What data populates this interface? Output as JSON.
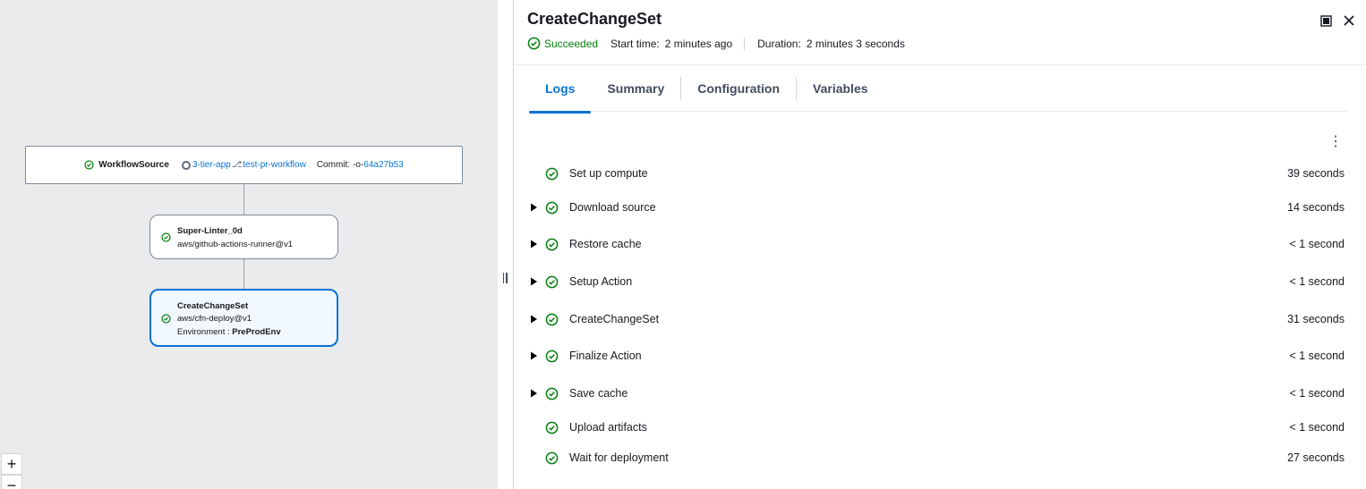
{
  "workflow": {
    "source_node": {
      "title": "WorkflowSource",
      "repo": "3-tier-app",
      "branch": "test-pr-workflow",
      "commit_label": "Commit:",
      "commit_id": "64a27b53"
    },
    "nodes": [
      {
        "title": "Super-Linter_0d",
        "action": "aws/github-actions-runner@v1"
      },
      {
        "title": "CreateChangeSet",
        "action": "aws/cfn-deploy@v1",
        "env_label": "Environment :",
        "env_value": "PreProdEnv"
      }
    ],
    "zoom_in": "+",
    "zoom_out": "−"
  },
  "panel": {
    "title": "CreateChangeSet",
    "status": "Succeeded",
    "start_label": "Start time:",
    "start_value": "2 minutes ago",
    "duration_label": "Duration:",
    "duration_value": "2 minutes 3 seconds",
    "tabs": [
      "Logs",
      "Summary",
      "Configuration",
      "Variables"
    ],
    "active_tab": "Logs",
    "steps": [
      {
        "name": "Set up compute",
        "duration": "39 seconds",
        "expandable": false
      },
      {
        "name": "Download source",
        "duration": "14 seconds",
        "expandable": true
      },
      {
        "name": "Restore cache",
        "duration": "< 1 second",
        "expandable": true
      },
      {
        "name": "Setup Action",
        "duration": "< 1 second",
        "expandable": true
      },
      {
        "name": "CreateChangeSet",
        "duration": "31 seconds",
        "expandable": true
      },
      {
        "name": "Finalize Action",
        "duration": "< 1 second",
        "expandable": true
      },
      {
        "name": "Save cache",
        "duration": "< 1 second",
        "expandable": true
      },
      {
        "name": "Upload artifacts",
        "duration": "< 1 second",
        "expandable": false
      },
      {
        "name": "Wait for deployment",
        "duration": "27 seconds",
        "expandable": false
      }
    ]
  },
  "colors": {
    "success": "#037f0c",
    "link": "#0972d3",
    "canvas": "#e9ebed"
  }
}
